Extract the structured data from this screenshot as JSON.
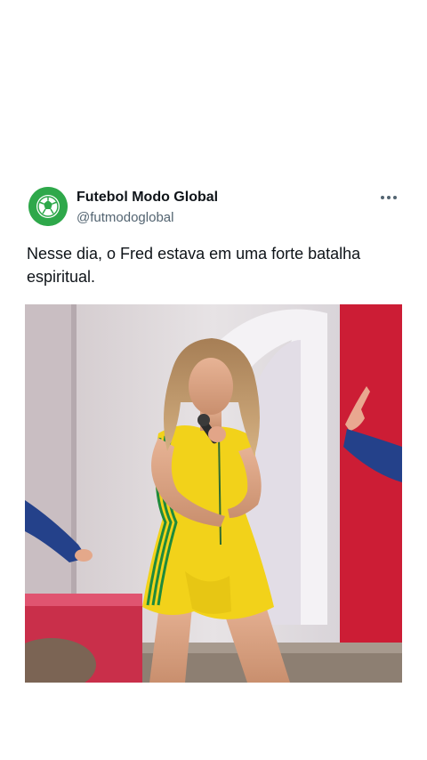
{
  "tweet": {
    "author": {
      "display_name": "Futebol Modo Global",
      "handle": "@futmodoglobal",
      "avatar_icon": "soccer-ball-avatar-icon",
      "avatar_color": "#2ea84a"
    },
    "text": "Nesse dia, o Fred estava em uma forte batalha espiritual.",
    "more_icon": "more-options-icon",
    "media": {
      "kind": "video-frame",
      "description_icon": "performer-video-thumbnail"
    }
  },
  "colors": {
    "text_primary": "#0f1419",
    "text_secondary": "#536471",
    "accent_red": "#d8203a",
    "jersey_yellow": "#f2d21a",
    "jersey_green": "#1f8a3b"
  }
}
